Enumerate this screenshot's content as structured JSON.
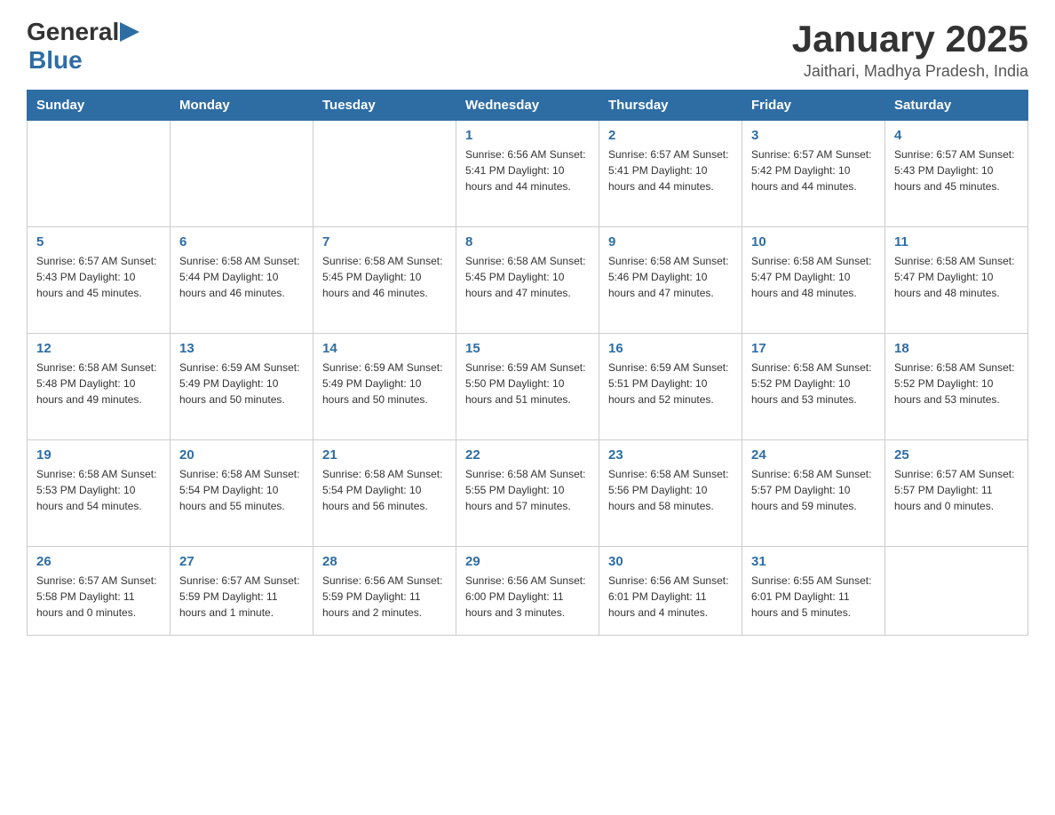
{
  "header": {
    "logo_general": "General",
    "logo_blue": "Blue",
    "title": "January 2025",
    "subtitle": "Jaithari, Madhya Pradesh, India"
  },
  "days_of_week": [
    "Sunday",
    "Monday",
    "Tuesday",
    "Wednesday",
    "Thursday",
    "Friday",
    "Saturday"
  ],
  "weeks": [
    {
      "days": [
        {
          "date": "",
          "info": ""
        },
        {
          "date": "",
          "info": ""
        },
        {
          "date": "",
          "info": ""
        },
        {
          "date": "1",
          "info": "Sunrise: 6:56 AM\nSunset: 5:41 PM\nDaylight: 10 hours\nand 44 minutes."
        },
        {
          "date": "2",
          "info": "Sunrise: 6:57 AM\nSunset: 5:41 PM\nDaylight: 10 hours\nand 44 minutes."
        },
        {
          "date": "3",
          "info": "Sunrise: 6:57 AM\nSunset: 5:42 PM\nDaylight: 10 hours\nand 44 minutes."
        },
        {
          "date": "4",
          "info": "Sunrise: 6:57 AM\nSunset: 5:43 PM\nDaylight: 10 hours\nand 45 minutes."
        }
      ]
    },
    {
      "days": [
        {
          "date": "5",
          "info": "Sunrise: 6:57 AM\nSunset: 5:43 PM\nDaylight: 10 hours\nand 45 minutes."
        },
        {
          "date": "6",
          "info": "Sunrise: 6:58 AM\nSunset: 5:44 PM\nDaylight: 10 hours\nand 46 minutes."
        },
        {
          "date": "7",
          "info": "Sunrise: 6:58 AM\nSunset: 5:45 PM\nDaylight: 10 hours\nand 46 minutes."
        },
        {
          "date": "8",
          "info": "Sunrise: 6:58 AM\nSunset: 5:45 PM\nDaylight: 10 hours\nand 47 minutes."
        },
        {
          "date": "9",
          "info": "Sunrise: 6:58 AM\nSunset: 5:46 PM\nDaylight: 10 hours\nand 47 minutes."
        },
        {
          "date": "10",
          "info": "Sunrise: 6:58 AM\nSunset: 5:47 PM\nDaylight: 10 hours\nand 48 minutes."
        },
        {
          "date": "11",
          "info": "Sunrise: 6:58 AM\nSunset: 5:47 PM\nDaylight: 10 hours\nand 48 minutes."
        }
      ]
    },
    {
      "days": [
        {
          "date": "12",
          "info": "Sunrise: 6:58 AM\nSunset: 5:48 PM\nDaylight: 10 hours\nand 49 minutes."
        },
        {
          "date": "13",
          "info": "Sunrise: 6:59 AM\nSunset: 5:49 PM\nDaylight: 10 hours\nand 50 minutes."
        },
        {
          "date": "14",
          "info": "Sunrise: 6:59 AM\nSunset: 5:49 PM\nDaylight: 10 hours\nand 50 minutes."
        },
        {
          "date": "15",
          "info": "Sunrise: 6:59 AM\nSunset: 5:50 PM\nDaylight: 10 hours\nand 51 minutes."
        },
        {
          "date": "16",
          "info": "Sunrise: 6:59 AM\nSunset: 5:51 PM\nDaylight: 10 hours\nand 52 minutes."
        },
        {
          "date": "17",
          "info": "Sunrise: 6:58 AM\nSunset: 5:52 PM\nDaylight: 10 hours\nand 53 minutes."
        },
        {
          "date": "18",
          "info": "Sunrise: 6:58 AM\nSunset: 5:52 PM\nDaylight: 10 hours\nand 53 minutes."
        }
      ]
    },
    {
      "days": [
        {
          "date": "19",
          "info": "Sunrise: 6:58 AM\nSunset: 5:53 PM\nDaylight: 10 hours\nand 54 minutes."
        },
        {
          "date": "20",
          "info": "Sunrise: 6:58 AM\nSunset: 5:54 PM\nDaylight: 10 hours\nand 55 minutes."
        },
        {
          "date": "21",
          "info": "Sunrise: 6:58 AM\nSunset: 5:54 PM\nDaylight: 10 hours\nand 56 minutes."
        },
        {
          "date": "22",
          "info": "Sunrise: 6:58 AM\nSunset: 5:55 PM\nDaylight: 10 hours\nand 57 minutes."
        },
        {
          "date": "23",
          "info": "Sunrise: 6:58 AM\nSunset: 5:56 PM\nDaylight: 10 hours\nand 58 minutes."
        },
        {
          "date": "24",
          "info": "Sunrise: 6:58 AM\nSunset: 5:57 PM\nDaylight: 10 hours\nand 59 minutes."
        },
        {
          "date": "25",
          "info": "Sunrise: 6:57 AM\nSunset: 5:57 PM\nDaylight: 11 hours\nand 0 minutes."
        }
      ]
    },
    {
      "days": [
        {
          "date": "26",
          "info": "Sunrise: 6:57 AM\nSunset: 5:58 PM\nDaylight: 11 hours\nand 0 minutes."
        },
        {
          "date": "27",
          "info": "Sunrise: 6:57 AM\nSunset: 5:59 PM\nDaylight: 11 hours\nand 1 minute."
        },
        {
          "date": "28",
          "info": "Sunrise: 6:56 AM\nSunset: 5:59 PM\nDaylight: 11 hours\nand 2 minutes."
        },
        {
          "date": "29",
          "info": "Sunrise: 6:56 AM\nSunset: 6:00 PM\nDaylight: 11 hours\nand 3 minutes."
        },
        {
          "date": "30",
          "info": "Sunrise: 6:56 AM\nSunset: 6:01 PM\nDaylight: 11 hours\nand 4 minutes."
        },
        {
          "date": "31",
          "info": "Sunrise: 6:55 AM\nSunset: 6:01 PM\nDaylight: 11 hours\nand 5 minutes."
        },
        {
          "date": "",
          "info": ""
        }
      ]
    }
  ]
}
